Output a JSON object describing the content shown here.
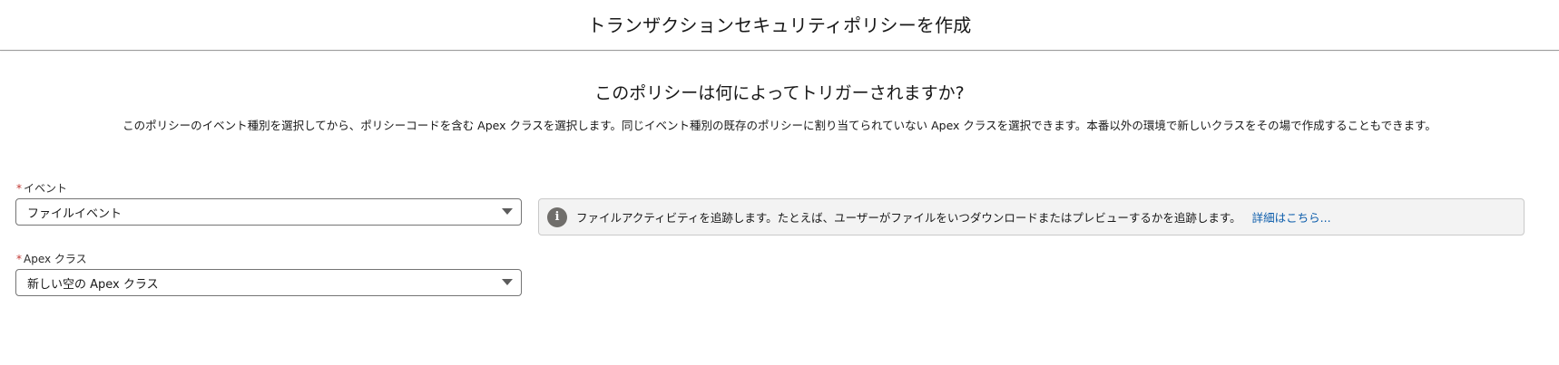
{
  "header": {
    "title": "トランザクションセキュリティポリシーを作成"
  },
  "main": {
    "question": "このポリシーは何によってトリガーされますか?",
    "description": "このポリシーのイベント種別を選択してから、ポリシーコードを含む Apex クラスを選択します。同じイベント種別の既存のポリシーに割り当てられていない Apex クラスを選択できます。本番以外の環境で新しいクラスをその場で作成することもできます。"
  },
  "event_field": {
    "required_marker": "*",
    "label": "イベント",
    "value": "ファイルイベント"
  },
  "apex_field": {
    "required_marker": "*",
    "label": "Apex クラス",
    "value": "新しい空の Apex クラス"
  },
  "info": {
    "icon": "info-icon",
    "icon_glyph": "i",
    "text": "ファイルアクティビティを追跡します。たとえば、ユーザーがファイルをいつダウンロードまたはプレビューするかを追跡します。",
    "link": "詳細はこちら..."
  },
  "colors": {
    "link": "#0b5cab",
    "required": "#c23934",
    "info_background": "#f3f3f3"
  }
}
